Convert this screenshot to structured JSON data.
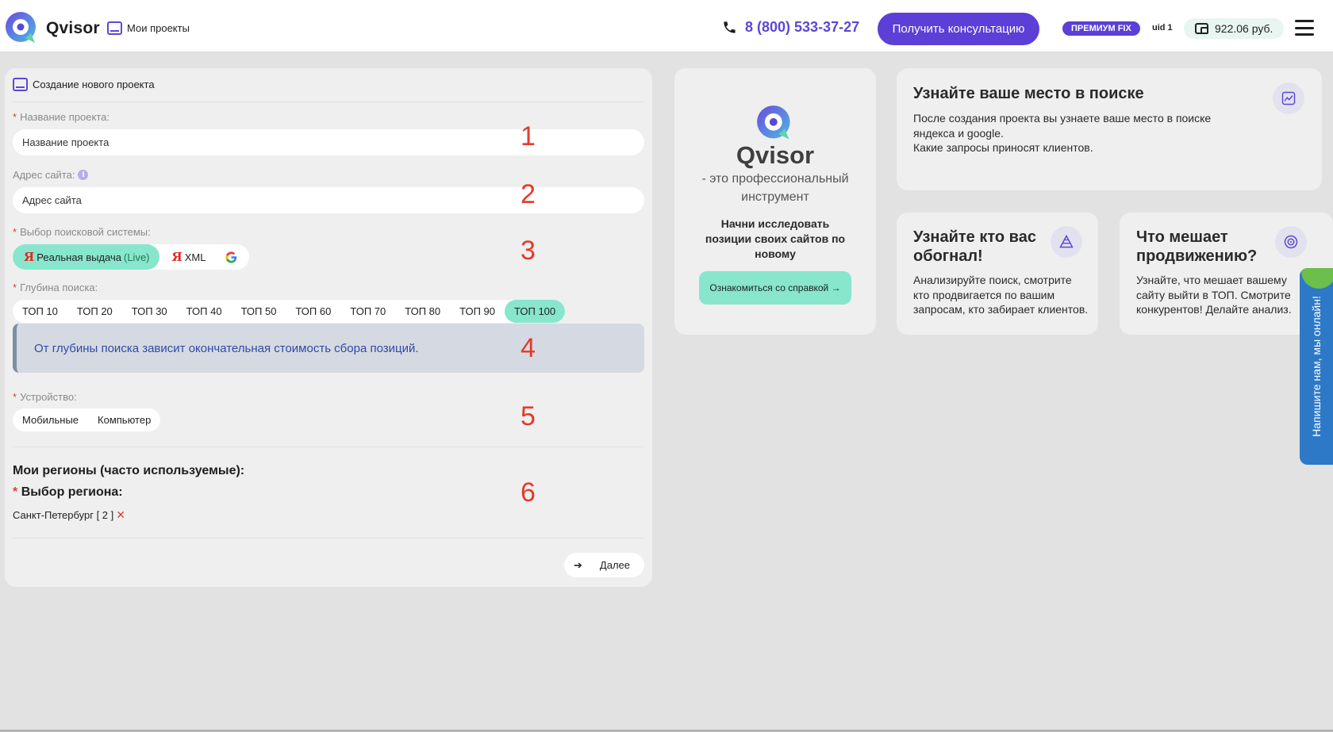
{
  "header": {
    "brand": "Qvisor",
    "projects_link": "Мои проекты",
    "phone": "8 (800) 533-37-27",
    "consult_button": "Получить консультацию",
    "plan_badge": "ПРЕМИУМ FIX",
    "uid": "uid 1",
    "balance": "922.06 руб."
  },
  "form": {
    "title": "Создание нового проекта",
    "project_name": {
      "label": "Название проекта:",
      "placeholder": "Название проекта"
    },
    "site_address": {
      "label": "Адрес сайта:",
      "placeholder": "Адрес сайта",
      "info": "i"
    },
    "search_engine": {
      "label": "Выбор поисковой системы:",
      "options": [
        {
          "ya": "Я",
          "label": "Реальная выдача",
          "suffix": "(Live)",
          "selected": true
        },
        {
          "ya": "Я",
          "label": "XML",
          "selected": false
        },
        {
          "icon": "google-icon",
          "selected": false
        }
      ]
    },
    "depth": {
      "label": "Глубина поиска:",
      "options": [
        "ТОП 10",
        "ТОП 20",
        "ТОП 30",
        "ТОП 40",
        "ТОП 50",
        "ТОП 60",
        "ТОП 70",
        "ТОП 80",
        "ТОП 90",
        "ТОП 100"
      ],
      "selected": "ТОП 100"
    },
    "notice": "От глубины поиска зависит окончательная стоимость сбора позиций.",
    "device": {
      "label": "Устройство:",
      "options": [
        "Мобильные",
        "Компьютер"
      ]
    },
    "regions_title": "Мои регионы (часто используемые):",
    "region_select_label": "Выбор региона:",
    "region_selected": "Санкт-Петербург [ 2 ]",
    "required_mark": "*",
    "remove_mark": "✕",
    "next_button": "Далее",
    "next_arrow": "➔"
  },
  "markers": [
    "1",
    "2",
    "3",
    "4",
    "5",
    "6"
  ],
  "promo": {
    "brand": "Qvisor",
    "tagline": "- это профессиональный инструмент",
    "subtitle": "Начни исследовать позиции своих сайтов по новому",
    "button": "Ознакомиться со справкой →"
  },
  "info_cards": [
    {
      "title": "Узнайте ваше место в поиске",
      "text": "После создания проекта вы узнаете ваше место в поиске яндекса и google.\nКакие запросы приносят клиентов.",
      "icon": "chart-icon"
    },
    {
      "title": "Узнайте кто вас обогнал!",
      "text": "Анализируйте поиск, смотрите кто продвигается по вашим запросам, кто забирает клиентов.",
      "icon": "pyramid-icon"
    },
    {
      "title": "Что мешает продвижению?",
      "text": "Узнайте, что мешает вашему сайту выйти в ТОП. Смотрите конкурентов! Делайте анализ.",
      "icon": "target-icon"
    }
  ],
  "chat_widget": "Напишите нам, мы онлайн!",
  "colors": {
    "accent": "#5b3fd6",
    "mint": "#87e6cc",
    "marker": "#e23b2a",
    "chat": "#2d79c8"
  }
}
